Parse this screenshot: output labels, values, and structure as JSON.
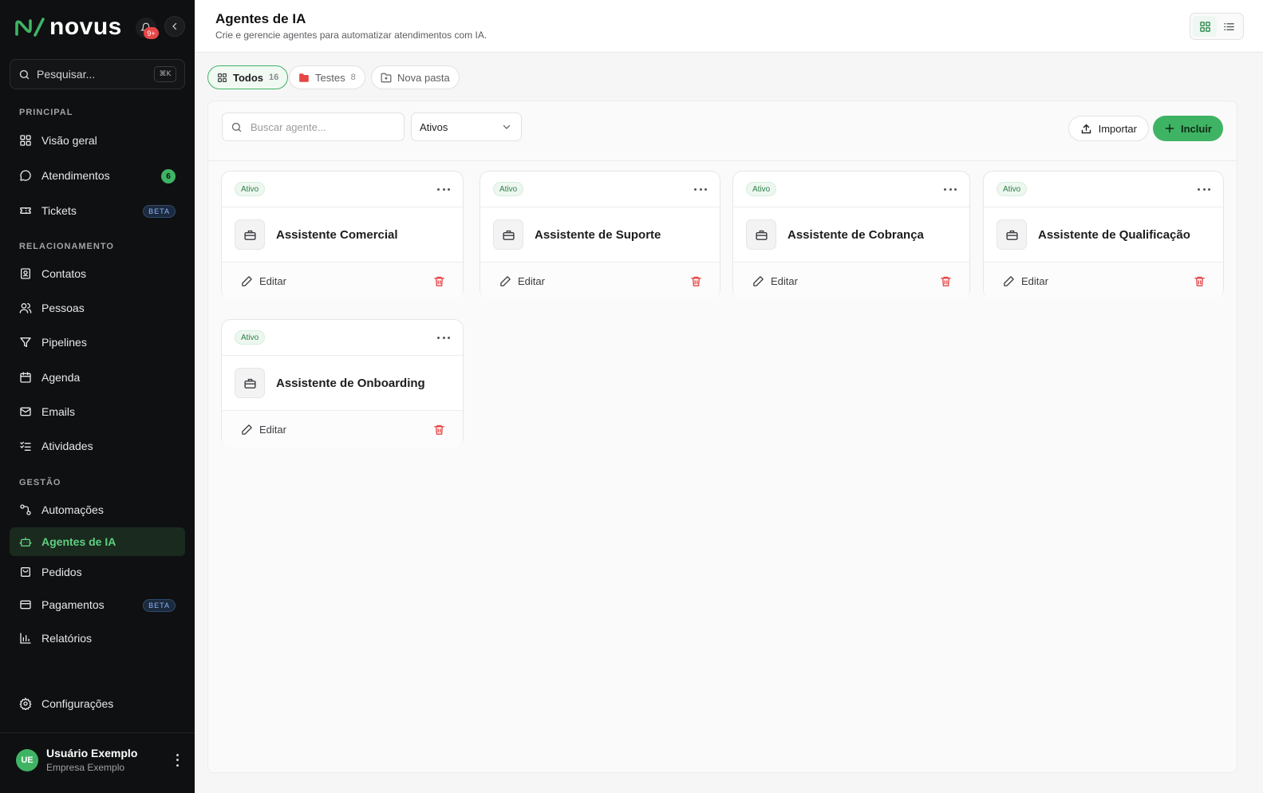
{
  "brand": {
    "name": "novus"
  },
  "notifications": {
    "badge": "9+"
  },
  "search": {
    "label": "Pesquisar...",
    "shortcut": "⌘K"
  },
  "sidebar": {
    "sections": [
      {
        "label": "PRINCIPAL"
      },
      {
        "label": "RELACIONAMENTO"
      },
      {
        "label": "GESTÃO"
      }
    ],
    "items": [
      {
        "label": "Visão geral",
        "icon": "grid-icon"
      },
      {
        "label": "Atendimentos",
        "icon": "chat-icon",
        "badge": "6"
      },
      {
        "label": "Tickets",
        "icon": "ticket-icon",
        "tag": "BETA"
      },
      {
        "label": "Contatos",
        "icon": "contact-icon"
      },
      {
        "label": "Pessoas",
        "icon": "people-icon"
      },
      {
        "label": "Pipelines",
        "icon": "filter-icon"
      },
      {
        "label": "Agenda",
        "icon": "calendar-icon"
      },
      {
        "label": "Emails",
        "icon": "mail-icon"
      },
      {
        "label": "Atividades",
        "icon": "checklist-icon"
      },
      {
        "label": "Automações",
        "icon": "workflow-icon"
      },
      {
        "label": "Agentes de IA",
        "icon": "bot-icon",
        "active": true
      },
      {
        "label": "Pedidos",
        "icon": "bag-icon"
      },
      {
        "label": "Pagamentos",
        "icon": "card-icon",
        "tag": "BETA"
      },
      {
        "label": "Relatórios",
        "icon": "bar-chart-icon"
      },
      {
        "label": "Configurações",
        "icon": "gear-icon"
      }
    ]
  },
  "user": {
    "initials": "UE",
    "name": "Usuário Exemplo",
    "company": "Empresa Exemplo"
  },
  "header": {
    "title": "Agentes de IA",
    "subtitle": "Crie e gerencie agentes para automatizar atendimentos com IA."
  },
  "folders": [
    {
      "label": "Todos",
      "count": "16",
      "active": true
    },
    {
      "label": "Testes",
      "count": "8"
    },
    {
      "label": "Nova pasta"
    }
  ],
  "toolbar": {
    "search_placeholder": "Buscar agente...",
    "status_value": "Ativos",
    "import_label": "Importar",
    "include_label": "Incluir"
  },
  "agents": [
    {
      "status": "Ativo",
      "name": "Assistente Comercial",
      "edit_label": "Editar"
    },
    {
      "status": "Ativo",
      "name": "Assistente de Suporte",
      "edit_label": "Editar"
    },
    {
      "status": "Ativo",
      "name": "Assistente de Cobrança",
      "edit_label": "Editar"
    },
    {
      "status": "Ativo",
      "name": "Assistente de Qualificação",
      "edit_label": "Editar"
    },
    {
      "status": "Ativo",
      "name": "Assistente de Onboarding",
      "edit_label": "Editar"
    }
  ],
  "colors": {
    "accent": "#3fb364",
    "sidebar_bg": "#0f1011",
    "danger": "#e74646"
  }
}
